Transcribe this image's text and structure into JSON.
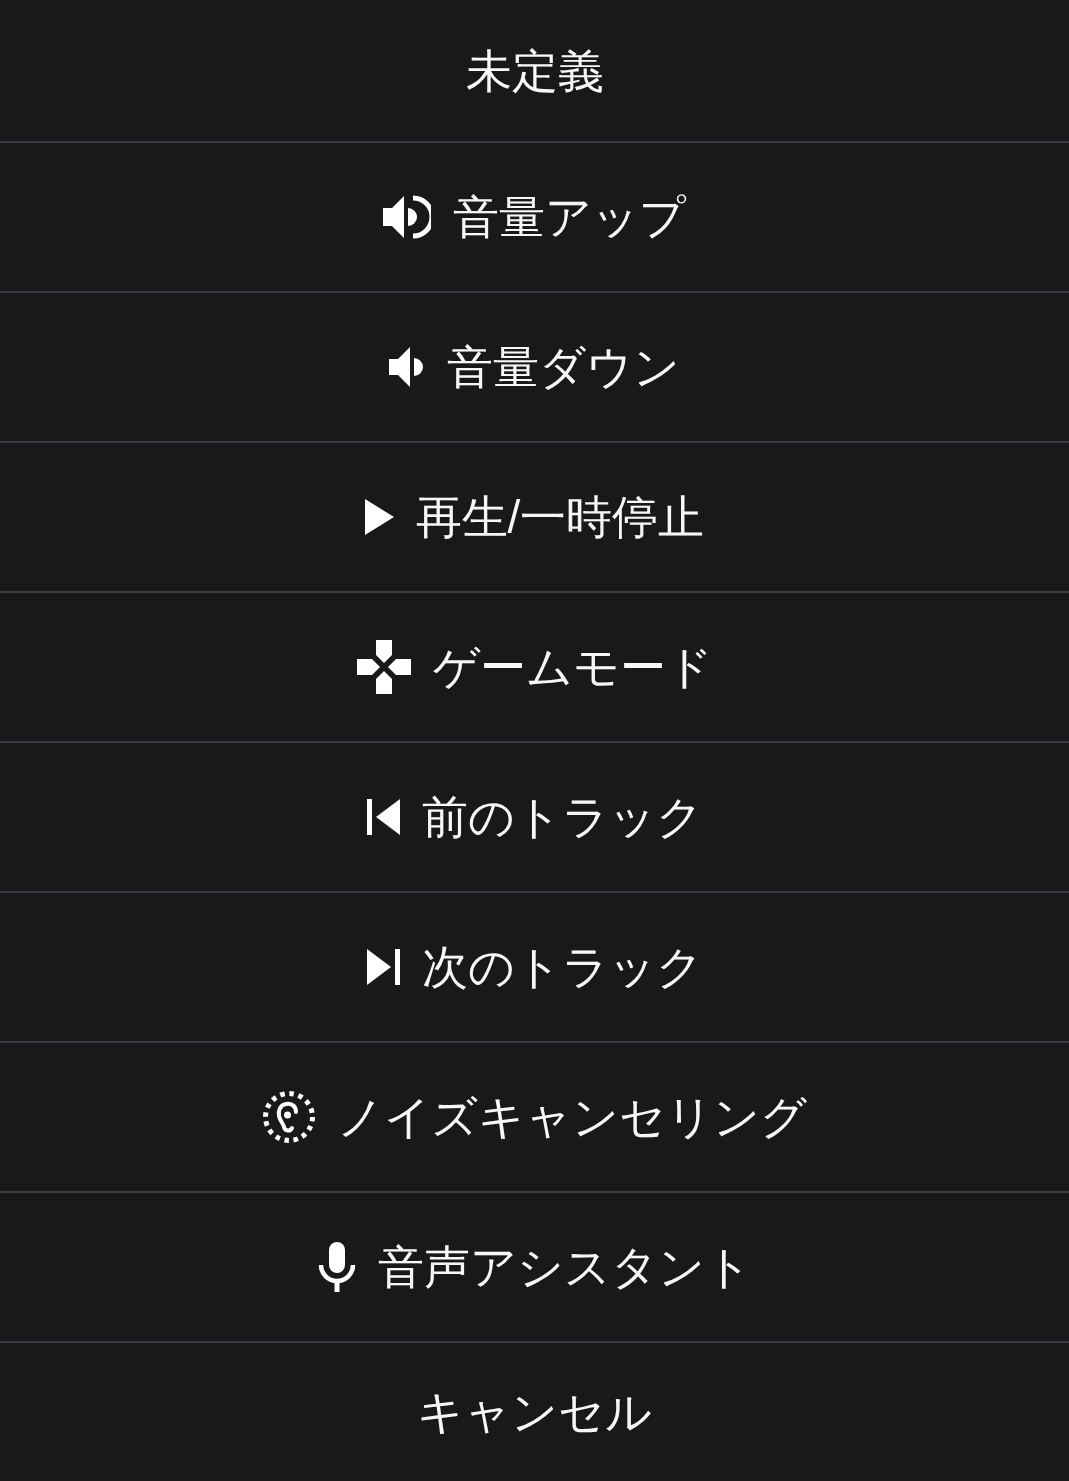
{
  "sheet": {
    "options": [
      {
        "kind": "plain",
        "label": "未定義"
      },
      {
        "kind": "volume_up",
        "label": "音量アップ"
      },
      {
        "kind": "volume_down",
        "label": "音量ダウン"
      },
      {
        "kind": "play",
        "label": "再生/一時停止"
      },
      {
        "kind": "game",
        "label": "ゲームモード"
      },
      {
        "kind": "previous",
        "label": "前のトラック"
      },
      {
        "kind": "next",
        "label": "次のトラック"
      },
      {
        "kind": "noise_cancel",
        "label": "ノイズキャンセリング"
      },
      {
        "kind": "voice",
        "label": "音声アシスタント"
      }
    ],
    "cancel": {
      "label": "キャンセル"
    }
  }
}
